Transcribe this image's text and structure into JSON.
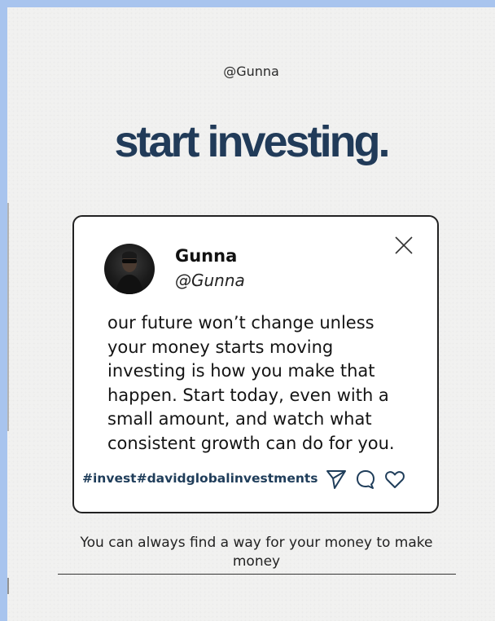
{
  "page": {
    "handle": "@Gunna",
    "headline": "start investing.",
    "caption": "You can always find a way for your money to make money",
    "colors": {
      "frame": "#a8c4ee",
      "background": "#f1f1f0",
      "headline": "#213b59",
      "hashtag": "#1f3d5a"
    }
  },
  "card": {
    "user": {
      "name": "Gunna",
      "handle": "@Gunna",
      "avatar": "avatar-photo"
    },
    "post_text": "our future won’t change unless\nyour money starts moving\ninvesting is how you make that\nhappen. Start today, even with a\nsmall amount, and watch what\nconsistent growth can do for you.",
    "hashtags": "#invest#davidglobalinvestments",
    "icons": {
      "close": "close-icon",
      "share": "send-icon",
      "comment": "comment-icon",
      "like": "heart-icon"
    }
  }
}
